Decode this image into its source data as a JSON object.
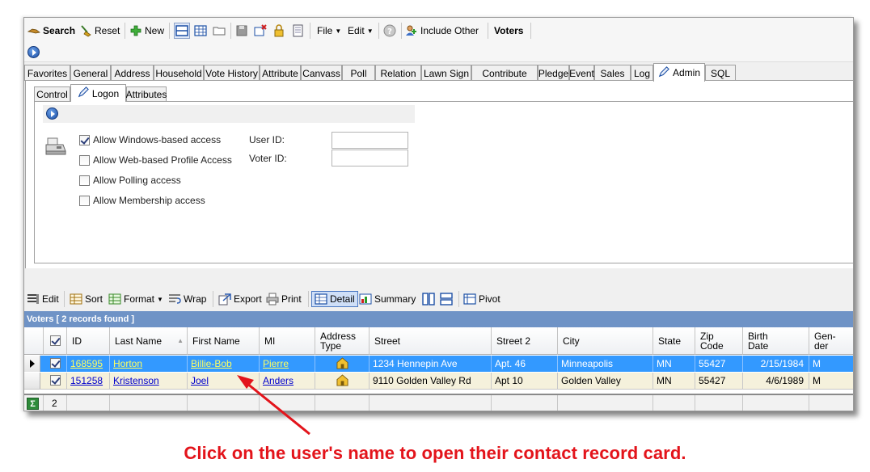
{
  "toolbar": {
    "search": "Search",
    "reset": "Reset",
    "new": "New",
    "file": "File",
    "edit": "Edit",
    "include_other": "Include Other",
    "voters": "Voters"
  },
  "tabs": [
    "Favorites",
    "General",
    "Address",
    "Household",
    "Vote History",
    "Attribute",
    "Canvass",
    "Poll",
    "Relation",
    "Lawn Sign",
    "Contribute",
    "Pledge",
    "Event",
    "Sales",
    "Log",
    "Admin",
    "SQL"
  ],
  "active_tab": "Admin",
  "subtabs": [
    "Control",
    "Logon",
    "Attributes"
  ],
  "active_subtab": "Logon",
  "logon": {
    "options": [
      {
        "label": "Allow Windows-based access",
        "checked": true
      },
      {
        "label": "Allow Web-based Profile Access",
        "checked": false
      },
      {
        "label": "Allow Polling access",
        "checked": false
      },
      {
        "label": "Allow Membership access",
        "checked": false
      }
    ],
    "user_id_label": "User ID:",
    "voter_id_label": "Voter ID:",
    "user_id_value": "",
    "voter_id_value": ""
  },
  "grid_toolbar": {
    "edit": "Edit",
    "sort": "Sort",
    "format": "Format",
    "wrap": "Wrap",
    "export": "Export",
    "print": "Print",
    "detail": "Detail",
    "summary": "Summary",
    "pivot": "Pivot"
  },
  "grid_caption": "Voters [ 2 records found ]",
  "columns": [
    {
      "label": "ID"
    },
    {
      "label": "Last Name"
    },
    {
      "label": "First Name"
    },
    {
      "label": "MI"
    },
    {
      "label": "Address Type",
      "l1": "Address",
      "l2": "Type"
    },
    {
      "label": "Street"
    },
    {
      "label": "Street 2"
    },
    {
      "label": "City"
    },
    {
      "label": "State"
    },
    {
      "label": "Zip Code",
      "l1": "Zip",
      "l2": "Code"
    },
    {
      "label": "Birth Date",
      "l1": "Birth",
      "l2": "Date"
    },
    {
      "label": "Gen-der",
      "l1": "Gen-",
      "l2": "der"
    }
  ],
  "rows": [
    {
      "id": "168595",
      "last": "Horton",
      "first": "Billie-Bob",
      "mi": "Pierre",
      "street": "1234 Hennepin Ave",
      "street2": "Apt. 46",
      "city": "Minneapolis",
      "state": "MN",
      "zip": "55427",
      "birth": "2/15/1984",
      "gender": "M",
      "checked": true,
      "selected": true
    },
    {
      "id": "151258",
      "last": "Kristenson",
      "first": "Joel",
      "mi": "Anders",
      "street": "9110 Golden Valley Rd",
      "street2": "Apt 10",
      "city": "Golden Valley",
      "state": "MN",
      "zip": "55427",
      "birth": "4/6/1989",
      "gender": "M",
      "checked": true,
      "selected": false
    }
  ],
  "footer_count": "2",
  "annotation": "Click on the user's name to open their contact record card.",
  "colors": {
    "selected_row": "#3399ff",
    "alt_row": "#f5f1dc",
    "caption_bar": "#6f93c6",
    "annotation": "#e3141b"
  }
}
